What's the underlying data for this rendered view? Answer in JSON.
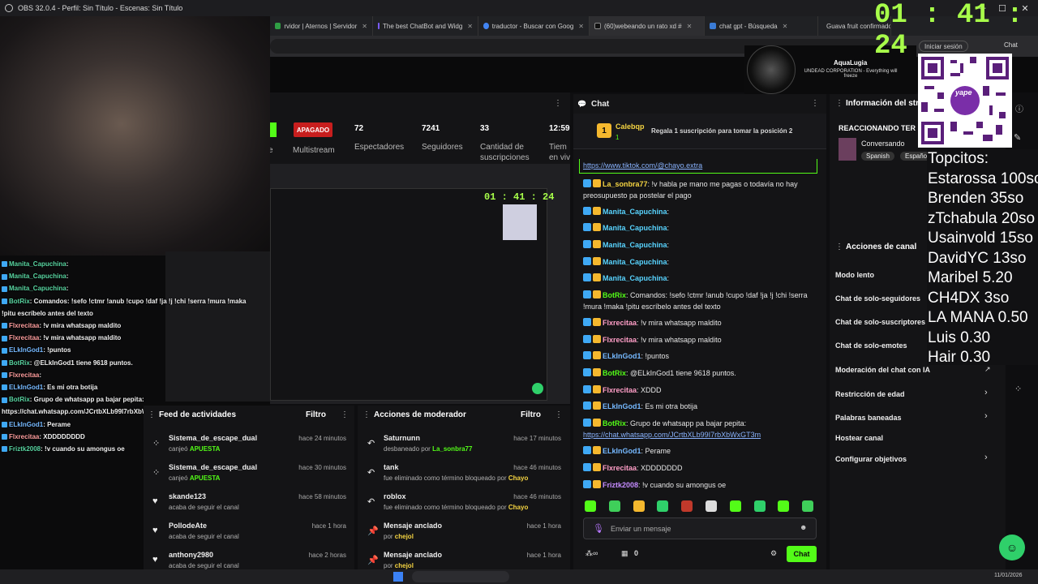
{
  "obs": {
    "title": "OBS 32.0.4 - Perfil: Sin Título - Escenas: Sin Título"
  },
  "browser": {
    "tabs": [
      {
        "label": "rvidor | Aternos | Servidor",
        "color": "#2f9e44"
      },
      {
        "label": "The best ChatBot and Widg",
        "color": "#7a5cff"
      },
      {
        "label": "traductor - Buscar con Goog",
        "color": "#4285f4"
      },
      {
        "label": "(60)webeando un rato xd #",
        "color": "#111111"
      },
      {
        "label": "chat gpt - Búsqueda",
        "color": "#3a7bd5"
      },
      {
        "label": "Guava fruit confirmado",
        "color": "#3a7bd5"
      }
    ],
    "signin_label": "Iniciar sesión",
    "chat_label": "Chat"
  },
  "timer": {
    "text": "01 : 41 : 24"
  },
  "profile": {
    "name": "AquaLugia",
    "bio": "UNDEAD CORPORATION - Everything will freeze"
  },
  "qr": {
    "label": "yape"
  },
  "topcitos": {
    "title": "Topcitos:",
    "lines": [
      "Estarossa 100so",
      "Brenden 35so",
      "zTchabula 20so",
      "Usainvold 15so",
      "DavidYC 13so",
      "Maribel 5.20",
      "CH4DX 3so",
      "LA MANA 0.50",
      "Luis 0.30",
      "Hair 0.30"
    ]
  },
  "stats": {
    "status": "APAGADO",
    "multistream": "Multistream",
    "viewers": "72",
    "viewers_label": "Espectadores",
    "followers": "7241",
    "followers_label": "Seguidores",
    "subs": "33",
    "subs_label1": "Cantidad de",
    "subs_label2": "suscripciones",
    "time": "12:59",
    "time_label1": "Tiem",
    "time_label2": "en viv"
  },
  "overlay_chat": [
    {
      "user": "Manita_Capuchina",
      "text": ":",
      "cls": "u"
    },
    {
      "user": "Manita_Capuchina",
      "text": ":",
      "cls": "u"
    },
    {
      "user": "Manita_Capuchina",
      "text": ":",
      "cls": "u"
    },
    {
      "user": "BotRix",
      "text": ": Comandos: !sefo !ctmr !anub !cupo !daf !ja !j !chi !serra !mura !maka",
      "cls": "u"
    },
    {
      "user": "",
      "text": "!pitu escríbelo antes del texto",
      "cls": ""
    },
    {
      "user": "Flxrecitaa",
      "text": ": !v mira whatsapp maldito",
      "cls": "u2"
    },
    {
      "user": "Flxrecitaa",
      "text": ": !v mira whatsapp maldito",
      "cls": "u2"
    },
    {
      "user": "ELkInGod1",
      "text": ": !puntos",
      "cls": "u3"
    },
    {
      "user": "BotRix",
      "text": ": @ELkInGod1 tiene 9618 puntos.",
      "cls": "u"
    },
    {
      "user": "Flxrecitaa",
      "text": ":",
      "cls": "u2"
    },
    {
      "user": "ELkInGod1",
      "text": ": Es mi otra botija",
      "cls": "u3"
    },
    {
      "user": "BotRix",
      "text": ": Grupo de whatsapp pa bajar pepita:",
      "cls": "u"
    },
    {
      "user": "",
      "text": "https://chat.whatsapp.com/JCrtbXLb99I7rbXbWxGT3m",
      "cls": ""
    },
    {
      "user": "ELkInGod1",
      "text": ": Perame",
      "cls": "u3"
    },
    {
      "user": "Flxrecitaa",
      "text": ": XDDDDDDDD",
      "cls": "u2"
    },
    {
      "user": "Friztk2008",
      "text": ": !v cuando su amongus oe",
      "cls": "u"
    }
  ],
  "chat": {
    "header": "Chat",
    "pinned_user": "Calebqp",
    "pinned_count": "1",
    "pinned_text": "Regala 1 suscripción para tomar la posición 2",
    "top_link": "https://www.tiktok.com/@chayo.extra",
    "messages": [
      {
        "user": "La_sonbra77",
        "color": "#f5d442",
        "text": ": !v habla pe mano me pagas o todavía no hay preosupuesto pa postelar el pago"
      },
      {
        "user": "Manita_Capuchina",
        "color": "#58d4ff",
        "text": ":"
      },
      {
        "user": "Manita_Capuchina",
        "color": "#58d4ff",
        "text": ":"
      },
      {
        "user": "Manita_Capuchina",
        "color": "#58d4ff",
        "text": ":"
      },
      {
        "user": "Manita_Capuchina",
        "color": "#58d4ff",
        "text": ":"
      },
      {
        "user": "Manita_Capuchina",
        "color": "#58d4ff",
        "text": ":"
      },
      {
        "user": "BotRix",
        "color": "#53fc18",
        "text": ": Comandos: !sefo !ctmr !anub !cupo !daf !ja !j !chi !serra !mura !maka !pitu escríbelo antes del texto"
      },
      {
        "user": "Flxrecitaa",
        "color": "#ff9ec7",
        "text": ": !v mira whatsapp maldito"
      },
      {
        "user": "Flxrecitaa",
        "color": "#ff9ec7",
        "text": ": !v mira whatsapp maldito"
      },
      {
        "user": "ELkInGod1",
        "color": "#76b9ff",
        "text": ": !puntos"
      },
      {
        "user": "BotRix",
        "color": "#53fc18",
        "text": ": @ELkInGod1 tiene 9618 puntos."
      },
      {
        "user": "Flxrecitaa",
        "color": "#ff9ec7",
        "text": ": XDDD"
      },
      {
        "user": "ELkInGod1",
        "color": "#76b9ff",
        "text": ": Es mi otra botija"
      },
      {
        "user": "BotRix",
        "color": "#53fc18",
        "text": ": Grupo de whatsapp pa bajar pepita:"
      },
      {
        "user": "",
        "color": "#8ab4ff",
        "text": "https://chat.whatsapp.com/JCrtbXLb99I7rbXbWxGT3m"
      },
      {
        "user": "ELkInGod1",
        "color": "#76b9ff",
        "text": ": Perame"
      },
      {
        "user": "Flxrecitaa",
        "color": "#ff9ec7",
        "text": ": XDDDDDDD"
      },
      {
        "user": "Friztk2008",
        "color": "#c58cff",
        "text": ": !v cuando su amongus oe"
      }
    ],
    "input_placeholder": "Enviar un mensaje",
    "points": "0",
    "send_label": "Chat"
  },
  "feed": {
    "title": "Feed de actividades",
    "filter": "Filtro",
    "items": [
      {
        "name": "Sistema_de_escape_dual",
        "sub": "canjeó",
        "hl": "APUESTA",
        "time": "hace 24 minutos"
      },
      {
        "name": "Sistema_de_escape_dual",
        "sub": "canjeó",
        "hl": "APUESTA",
        "time": "hace 30 minutos"
      },
      {
        "name": "skande123",
        "sub": "acaba de seguir el canal",
        "hl": "",
        "time": "hace 58 minutos"
      },
      {
        "name": "PollodeAte",
        "sub": "acaba de seguir el canal",
        "hl": "",
        "time": "hace 1 hora"
      },
      {
        "name": "anthony2980",
        "sub": "acaba de seguir el canal",
        "hl": "",
        "time": "hace 2 horas"
      }
    ]
  },
  "mod": {
    "title": "Acciones de moderador",
    "filter": "Filtro",
    "items": [
      {
        "name": "Saturnunn",
        "sub": "desbaneado por",
        "hl": "La_sonbra77",
        "time": "hace 17 minutos"
      },
      {
        "name": "tank",
        "sub": "fue eliminado como término bloqueado por",
        "hl": "Chayo",
        "time": "hace 46 minutos"
      },
      {
        "name": "roblox",
        "sub": "fue eliminado como término bloqueado por",
        "hl": "Chayo",
        "time": "hace 46 minutos"
      },
      {
        "name": "Mensaje anclado",
        "sub": "por",
        "hl": "chejol",
        "time": "hace 1 hora"
      },
      {
        "name": "Mensaje anclado",
        "sub": "por",
        "hl": "chejol",
        "time": "hace 1 hora"
      }
    ]
  },
  "info": {
    "title": "Información del stre",
    "stream_title": "REACCIONANDO TER",
    "category": "Conversando",
    "tag1": "Spanish",
    "tag2": "Españo"
  },
  "actions": {
    "title": "Acciones de canal",
    "items": [
      "Modo lento",
      "Chat de solo-seguidores",
      "Chat de solo-suscriptores",
      "Chat de solo-emotes",
      "Moderación del chat con IA",
      "Restricción de edad",
      "Palabras baneadas",
      "Hostear canal",
      "Configurar objetivos"
    ]
  },
  "taskbar": {
    "date": "11/01/2026"
  }
}
